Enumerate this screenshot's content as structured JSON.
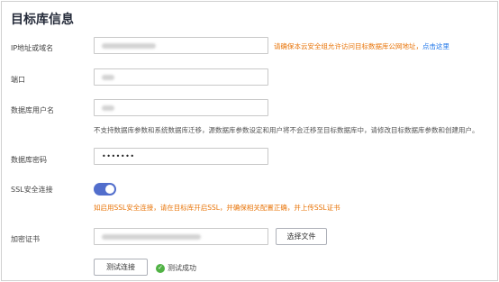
{
  "page": {
    "title": "目标库信息"
  },
  "fields": {
    "ip": {
      "label": "IP地址或域名"
    },
    "port": {
      "label": "端口"
    },
    "user": {
      "label": "数据库用户名"
    },
    "password": {
      "label": "数据库密码",
      "value": "•••••••"
    },
    "ssl": {
      "label": "SSL安全连接",
      "enabled": true
    },
    "cert": {
      "label": "加密证书"
    }
  },
  "hints": {
    "ip_hint": "请确保本云安全组允许访问目标数据库公网地址，",
    "ip_link": "点击这里",
    "user_hint": "不支持数据库参数和系统数据库迁移，源数据库参数设定和用户将不会迁移至目标数据库中，请修改目标数据库参数和创建用户。",
    "ssl_hint": "如启用SSL安全连接，请在目标库开启SSL，并确保相关配置正确，并上传SSL证书"
  },
  "buttons": {
    "select_file": "选择文件",
    "test_connection": "测试连接"
  },
  "status": {
    "test_result": "测试成功",
    "color": "#50b244"
  },
  "colors": {
    "accent": "#526ecc",
    "warning": "#e8750a",
    "link": "#1a73e8"
  }
}
